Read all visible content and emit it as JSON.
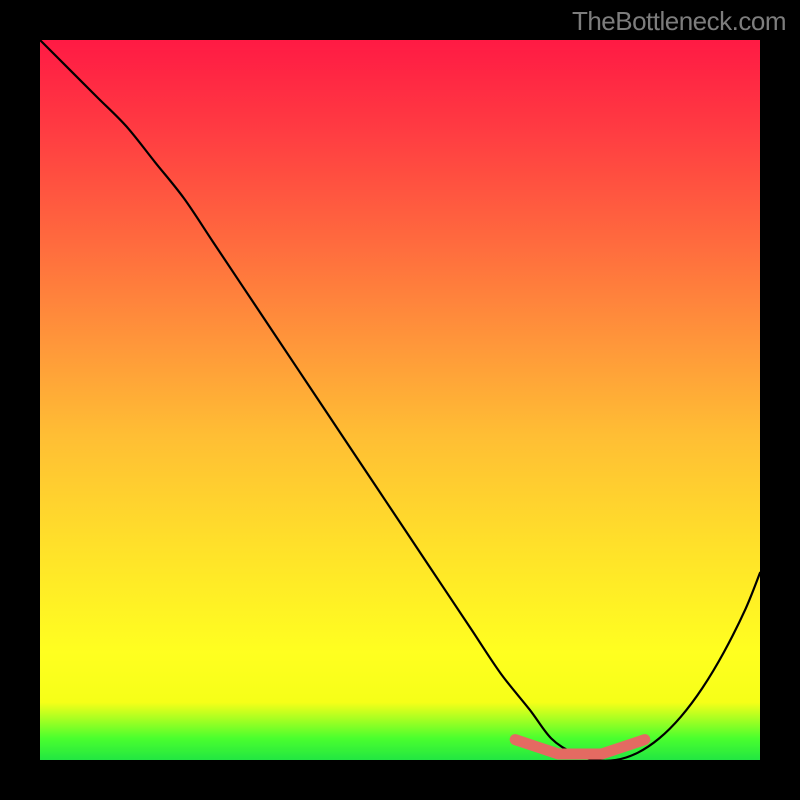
{
  "watermark": "TheBottleneck.com",
  "colors": {
    "background": "#000000",
    "gradient_top": "#ff1a44",
    "gradient_mid_high": "#ff963a",
    "gradient_mid_low": "#ffff20",
    "gradient_bottom": "#22e642",
    "curve": "#000000",
    "fit_region": "#e46a62",
    "watermark_text": "#7d7d7d"
  },
  "chart_data": {
    "type": "line",
    "title": "",
    "xlabel": "",
    "ylabel": "",
    "x_range": [
      0,
      100
    ],
    "y_range": [
      0,
      100
    ],
    "series": [
      {
        "name": "bottleneck-curve",
        "x": [
          0,
          4,
          8,
          12,
          16,
          20,
          24,
          28,
          32,
          36,
          40,
          44,
          48,
          52,
          56,
          60,
          64,
          68,
          71,
          74,
          77,
          80,
          83,
          86,
          89,
          92,
          95,
          98,
          100
        ],
        "values": [
          100,
          96,
          92,
          88,
          83,
          78,
          72,
          66,
          60,
          54,
          48,
          42,
          36,
          30,
          24,
          18,
          12,
          7,
          3,
          1,
          0,
          0,
          1,
          3,
          6,
          10,
          15,
          21,
          26
        ]
      }
    ],
    "fit_region": {
      "name": "optimal-fit-band",
      "x": [
        66,
        69,
        72,
        75,
        78,
        81,
        84
      ],
      "values": [
        2,
        1,
        0,
        0,
        0,
        1,
        2
      ]
    },
    "notes": "x and y are normalized 0-100; y=0 is best (no bottleneck), y=100 is worst. Curve minimum around x≈76-80."
  }
}
